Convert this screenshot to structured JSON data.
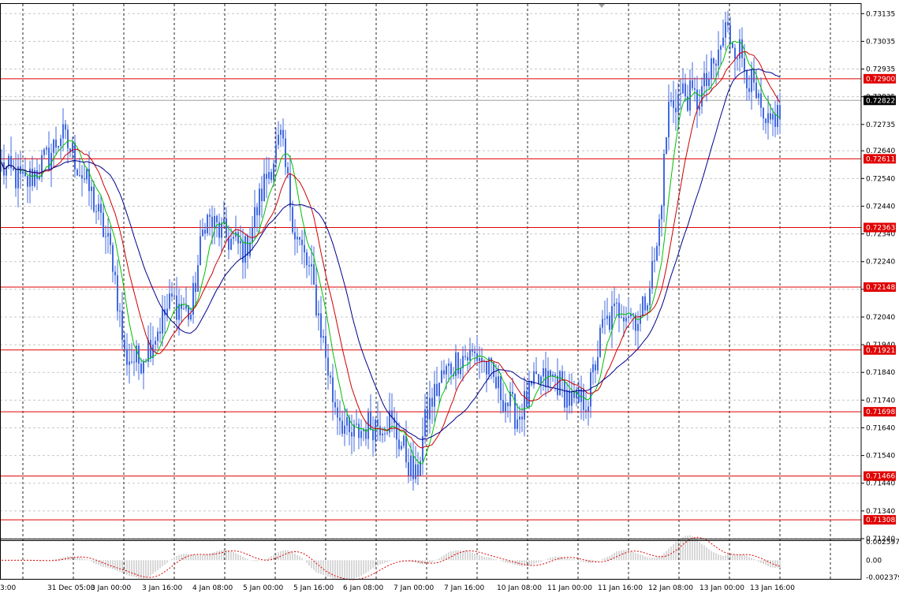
{
  "chart_data": {
    "type": "candlestick",
    "price_axis": {
      "range": [
        0.7124,
        0.7317
      ],
      "ticks": [
        "0.73135",
        "0.73035",
        "0.72935",
        "0.72835",
        "0.72735",
        "0.72640",
        "0.72540",
        "0.72440",
        "0.72340",
        "0.72240",
        "0.72140",
        "0.72040",
        "0.71940",
        "0.71840",
        "0.71740",
        "0.71640",
        "0.71540",
        "0.71440",
        "0.71340",
        "0.71240"
      ]
    },
    "time_axis": {
      "labels": [
        "3:00",
        "31 Dec 05:00",
        "3 Jan 00:00",
        "3 Jan 16:00",
        "4 Jan 08:00",
        "5 Jan 00:00",
        "5 Jan 16:00",
        "6 Jan 08:00",
        "7 Jan 00:00",
        "7 Jan 16:00",
        "10 Jan 08:00",
        "11 Jan 00:00",
        "11 Jan 16:00",
        "12 Jan 08:00",
        "13 Jan 00:00",
        "13 Jan 16:00"
      ]
    },
    "grid": true,
    "levels": [
      {
        "label": "0.72900",
        "value": 0.729
      },
      {
        "label": "0.72611",
        "value": 0.72611
      },
      {
        "label": "0.72363",
        "value": 0.72363
      },
      {
        "label": "0.72148",
        "value": 0.72148
      },
      {
        "label": "0.71921",
        "value": 0.71921
      },
      {
        "label": "0.71698",
        "value": 0.71698
      },
      {
        "label": "0.71466",
        "value": 0.71466
      },
      {
        "label": "0.71308",
        "value": 0.71308
      }
    ],
    "current_price": {
      "label": "0.72822",
      "value": 0.72822
    },
    "price_anchors": [
      [
        0,
        0.7258
      ],
      [
        10,
        0.7252
      ],
      [
        20,
        0.7262
      ],
      [
        25,
        0.727
      ],
      [
        30,
        0.7263
      ],
      [
        38,
        0.7248
      ],
      [
        47,
        0.7225
      ],
      [
        52,
        0.719
      ],
      [
        58,
        0.7188
      ],
      [
        65,
        0.7198
      ],
      [
        72,
        0.721
      ],
      [
        80,
        0.7205
      ],
      [
        86,
        0.724
      ],
      [
        96,
        0.7232
      ],
      [
        103,
        0.7228
      ],
      [
        112,
        0.7255
      ],
      [
        118,
        0.7268
      ],
      [
        124,
        0.7235
      ],
      [
        131,
        0.7218
      ],
      [
        135,
        0.72
      ],
      [
        140,
        0.7175
      ],
      [
        147,
        0.716
      ],
      [
        155,
        0.7165
      ],
      [
        164,
        0.7167
      ],
      [
        170,
        0.7156
      ],
      [
        175,
        0.7145
      ],
      [
        180,
        0.717
      ],
      [
        186,
        0.7182
      ],
      [
        194,
        0.719
      ],
      [
        202,
        0.719
      ],
      [
        210,
        0.7178
      ],
      [
        218,
        0.7168
      ],
      [
        226,
        0.718
      ],
      [
        234,
        0.7182
      ],
      [
        242,
        0.7172
      ],
      [
        248,
        0.7175
      ],
      [
        254,
        0.72
      ],
      [
        262,
        0.7208
      ],
      [
        270,
        0.7203
      ],
      [
        277,
        0.7228
      ],
      [
        282,
        0.728
      ],
      [
        288,
        0.7285
      ],
      [
        294,
        0.7282
      ],
      [
        302,
        0.7295
      ],
      [
        306,
        0.7308
      ],
      [
        312,
        0.73
      ],
      [
        318,
        0.7285
      ],
      [
        323,
        0.727
      ],
      [
        327,
        0.7277
      ]
    ],
    "indicators": {
      "ma_fast": {
        "color": "#00c000"
      },
      "ma_mid": {
        "color": "#cc0000"
      },
      "ma_slow": {
        "color": "#00008b"
      }
    },
    "oscillator": {
      "ticks": [
        "0.002597",
        "0.00",
        "-0.002379"
      ],
      "range": [
        -0.0026,
        0.0028
      ]
    }
  }
}
